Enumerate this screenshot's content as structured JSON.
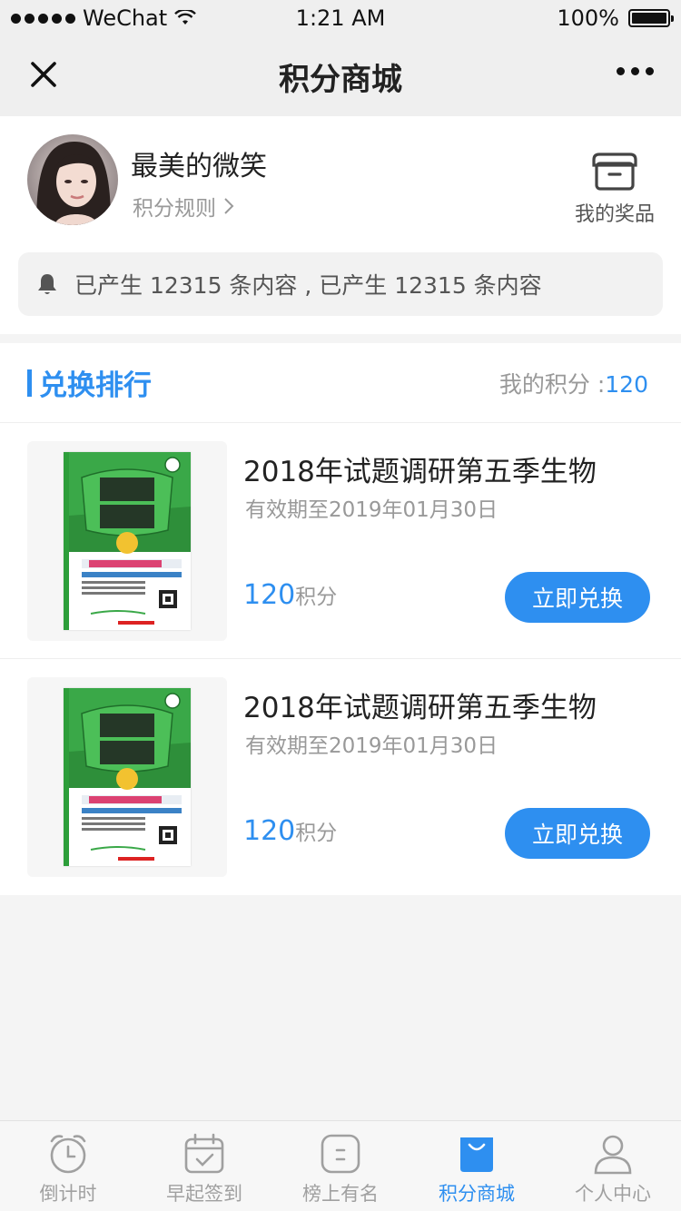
{
  "status_bar": {
    "carrier": "WeChat",
    "time": "1:21 AM",
    "battery": "100%"
  },
  "nav": {
    "title": "积分商城"
  },
  "profile": {
    "name": "最美的微笑",
    "rules_label": "积分规则",
    "prizes_label": "我的奖品",
    "notice": "已产生 12315 条内容 , 已产生 12315 条内容"
  },
  "ranking": {
    "title": "兑换排行",
    "my_points_label": "我的积分 :",
    "my_points_value": "120",
    "items": [
      {
        "title": "2018年试题调研第五季生物",
        "expiry": "有效期至2019年01月30日",
        "price": "120",
        "price_unit": "积分",
        "button": "立即兑换"
      },
      {
        "title": "2018年试题调研第五季生物",
        "expiry": "有效期至2019年01月30日",
        "price": "120",
        "price_unit": "积分",
        "button": "立即兑换"
      }
    ]
  },
  "tabs": [
    {
      "label": "倒计时",
      "icon": "alarm-clock-icon"
    },
    {
      "label": "早起签到",
      "icon": "calendar-check-icon"
    },
    {
      "label": "榜上有名",
      "icon": "ranking-face-icon"
    },
    {
      "label": "积分商城",
      "icon": "shopping-bag-icon",
      "active": true
    },
    {
      "label": "个人中心",
      "icon": "person-icon"
    }
  ],
  "colors": {
    "accent": "#2e8ff0",
    "tab_inactive": "#a0a0a0"
  }
}
